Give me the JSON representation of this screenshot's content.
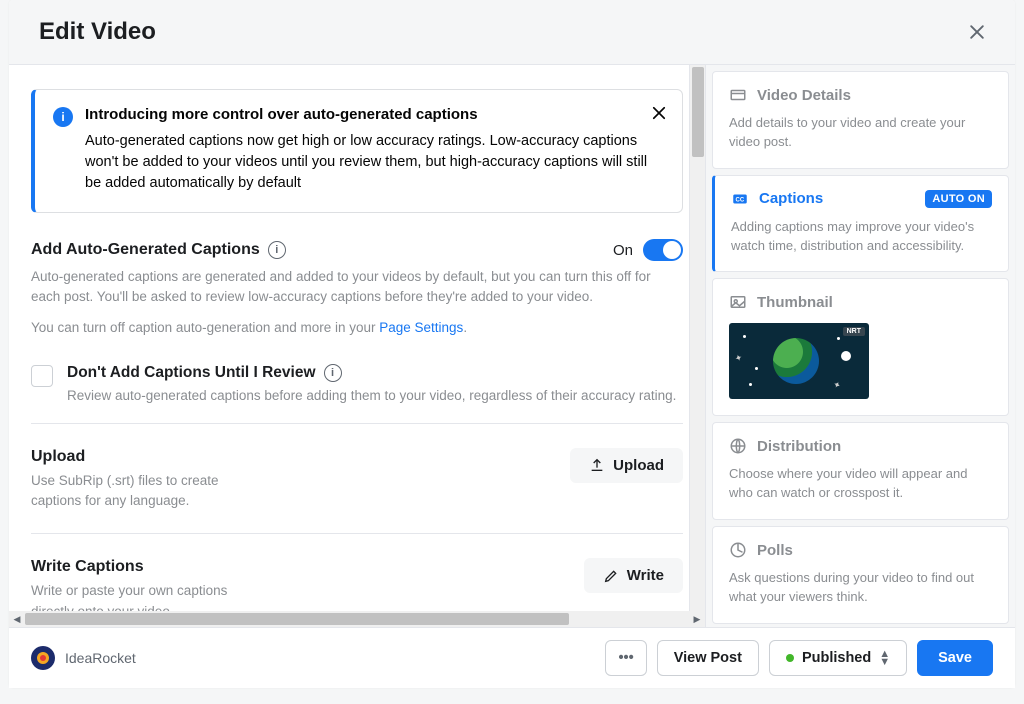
{
  "header": {
    "title": "Edit Video"
  },
  "banner": {
    "title": "Introducing more control over auto-generated captions",
    "body": "Auto-generated captions now get high or low accuracy ratings. Low-accuracy captions won't be added to your videos until you review them, but high-accuracy captions will still be added automatically by default"
  },
  "autogen": {
    "title": "Add Auto-Generated Captions",
    "toggle_label": "On",
    "desc1": "Auto-generated captions are generated and added to your videos by default, but you can turn this off for each post. You'll be asked to review low-accuracy captions before they're added to your video.",
    "desc2_prefix": "You can turn off caption auto-generation and more in your ",
    "page_settings": "Page Settings",
    "period": "."
  },
  "reviewCheck": {
    "title": "Don't Add Captions Until I Review",
    "desc": "Review auto-generated captions before adding them to your video, regardless of their accuracy rating."
  },
  "upload": {
    "title": "Upload",
    "desc": "Use SubRip (.srt) files to create captions for any language.",
    "button": "Upload"
  },
  "write": {
    "title": "Write Captions",
    "desc": "Write or paste your own captions directly onto your video.",
    "button": "Write"
  },
  "sidebar": {
    "details": {
      "title": "Video Details",
      "desc": "Add details to your video and create your video post."
    },
    "captions": {
      "title": "Captions",
      "badge": "AUTO ON",
      "desc": "Adding captions may improve your video's watch time, distribution and accessibility."
    },
    "thumbnail": {
      "title": "Thumbnail",
      "thumb_tag": "NRT"
    },
    "distribution": {
      "title": "Distribution",
      "desc": "Choose where your video will appear and who can watch or crosspost it."
    },
    "polls": {
      "title": "Polls",
      "desc": "Ask questions during your video to find out what your viewers think."
    }
  },
  "footer": {
    "author": "IdeaRocket",
    "view_post": "View Post",
    "published": "Published",
    "save": "Save"
  }
}
